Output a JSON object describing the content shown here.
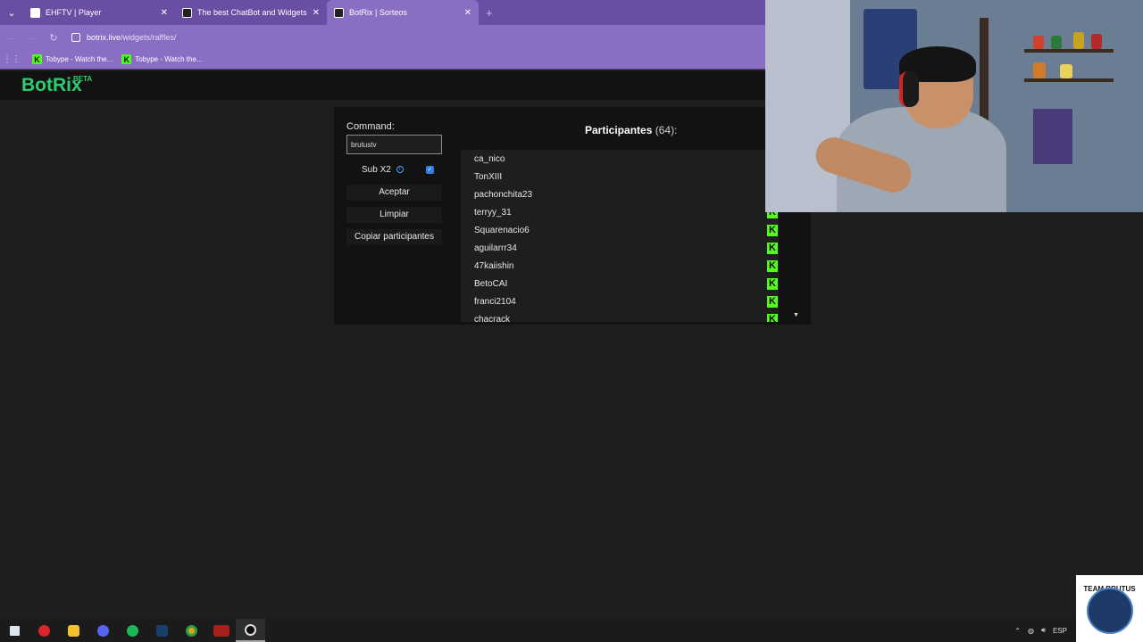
{
  "browser": {
    "tabs": [
      {
        "label": "EHFTV | Player",
        "active": false
      },
      {
        "label": "The best ChatBot and Widgets",
        "active": false
      },
      {
        "label": "BotRix | Sorteos",
        "active": true
      }
    ],
    "new_tab_symbol": "+",
    "url_domain": "botrix.live",
    "url_path": "/widgets/raffles/",
    "bookmarks": [
      {
        "label": "Tobype - Watch the..."
      },
      {
        "label": "Tobype - Watch the..."
      }
    ]
  },
  "app": {
    "logo": "BotRix",
    "beta": "BETA"
  },
  "raffle": {
    "command_label": "Command:",
    "command_value": "brutustv",
    "sub_x2_label": "Sub X2",
    "sub_x2_checked": true,
    "accept_label": "Aceptar",
    "clear_label": "Limpiar",
    "copy_label": "Copiar participantes",
    "participants_title": "Participantes",
    "participants_count": "(64):",
    "participants": [
      "ca_nico",
      "TonXIII",
      "pachonchita23",
      "terryy_31",
      "Squarenacio6",
      "aguilarrr34",
      "47kaiishin",
      "BetoCAI",
      "franci2104",
      "chacrack"
    ]
  },
  "overlay": {
    "team_logo_text": "TEAM BRUTUS"
  },
  "taskbar": {
    "apps": [
      "windows-start",
      "red-app",
      "file-explorer",
      "discord",
      "spotify",
      "steam",
      "chrome",
      "voicemeeter",
      "obs"
    ],
    "tray_language": "ESP"
  },
  "colors": {
    "browser_accent": "#8a6ec4",
    "brand_green": "#2ecc71",
    "kick_green": "#53fc18"
  }
}
